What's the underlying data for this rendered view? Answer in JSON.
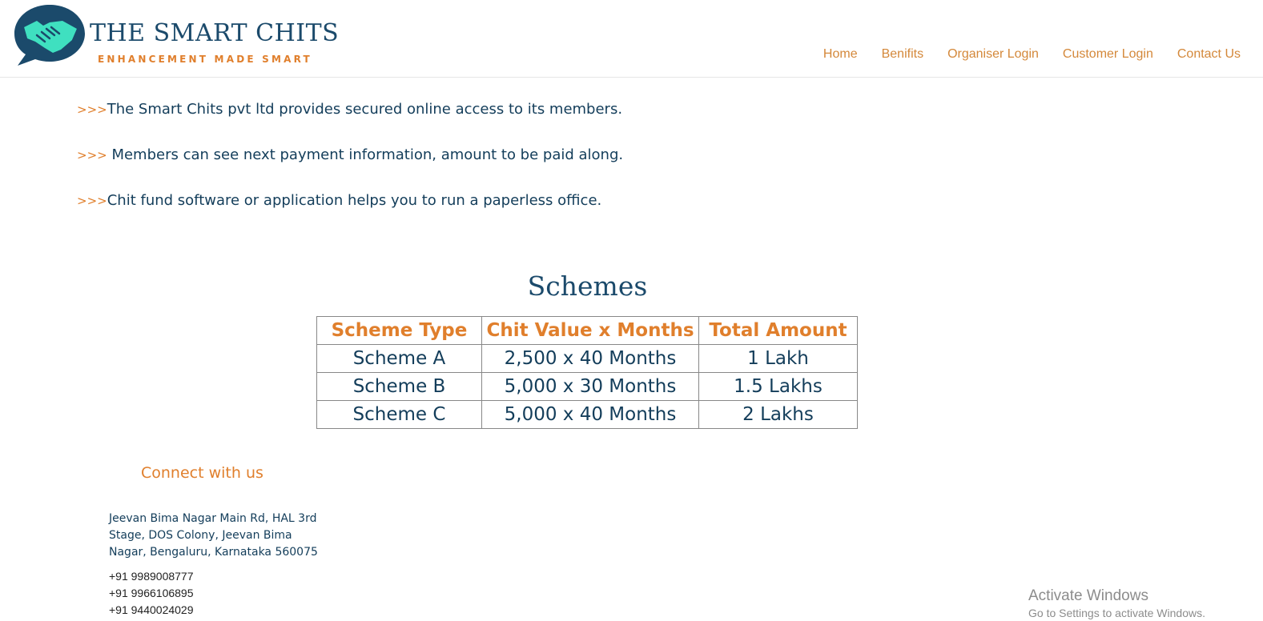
{
  "brand": {
    "title": "THE SMART CHITS",
    "tagline": "ENHANCEMENT MADE SMART",
    "icon": "handshake-chat-icon",
    "colors": {
      "navy": "#1b4a6b",
      "orange": "#e07f2c",
      "teal": "#3fe0c0"
    }
  },
  "nav": {
    "items": [
      "Home",
      "Benifits",
      "Organiser Login",
      "Customer Login",
      "Contact Us"
    ]
  },
  "points": [
    {
      "marker": ">>>",
      "text": "The Smart Chits pvt ltd provides secured online access to its members."
    },
    {
      "marker": ">>>",
      "text": " Members can see next payment information, amount to be paid along."
    },
    {
      "marker": ">>>",
      "text": "Chit fund software or application helps you to run a paperless office."
    }
  ],
  "schemes": {
    "title": "Schemes",
    "headers": [
      "Scheme Type",
      "Chit Value x Months",
      "Total Amount"
    ],
    "rows": [
      [
        "Scheme A",
        "2,500 x 40 Months",
        "1 Lakh"
      ],
      [
        "Scheme B",
        "5,000 x 30 Months",
        "1.5 Lakhs"
      ],
      [
        "Scheme C",
        "5,000 x 40 Months",
        "2 Lakhs"
      ]
    ]
  },
  "footer": {
    "connect_label": "Connect with us",
    "address_lines": [
      "Jeevan Bima Nagar Main Rd, HAL 3rd",
      "Stage, DOS Colony, Jeevan Bima",
      "Nagar, Bengaluru, Karnataka 560075"
    ],
    "phones": [
      "+91 9989008777",
      "+91 9966106895",
      "+91 9440024029"
    ]
  },
  "watermark": {
    "line1": "Activate Windows",
    "line2": "Go to Settings to activate Windows."
  }
}
